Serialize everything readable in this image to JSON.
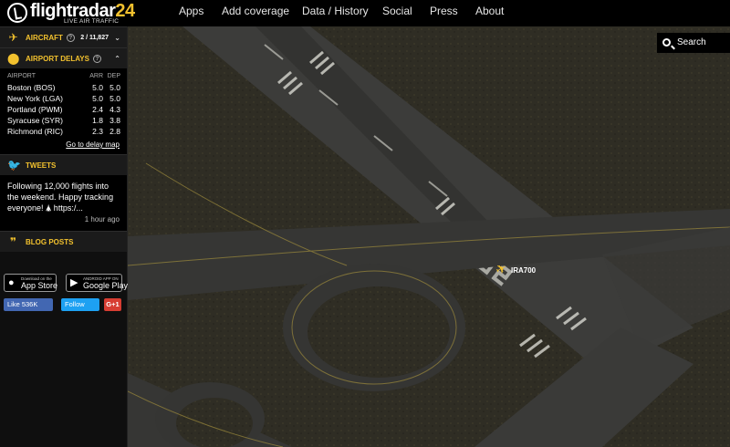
{
  "brand": {
    "name_main": "flightradar",
    "name_num": "24",
    "tagline": "LIVE AIR TRAFFIC"
  },
  "nav": [
    "Apps",
    "Add coverage",
    "Data / History",
    "Social",
    "Press",
    "About"
  ],
  "search": {
    "label": "Search"
  },
  "aircraft": {
    "title": "AIRCRAFT",
    "count": "2 / 11,827"
  },
  "delays": {
    "title": "AIRPORT DELAYS",
    "columns": [
      "AIRPORT",
      "ARR",
      "DEP"
    ],
    "rows": [
      [
        "Boston (BOS)",
        "5.0",
        "5.0"
      ],
      [
        "New York (LGA)",
        "5.0",
        "5.0"
      ],
      [
        "Portland (PWM)",
        "2.4",
        "4.3"
      ],
      [
        "Syracuse (SYR)",
        "1.8",
        "3.8"
      ],
      [
        "Richmond (RIC)",
        "2.3",
        "2.8"
      ]
    ],
    "link": "Go to delay map"
  },
  "tweets": {
    "title": "TWEETS",
    "text": "Following 12,000 flights into the weekend. Happy tracking everyone! 🛦 https:/...",
    "time": "1 hour ago"
  },
  "blog": {
    "title": "BLOG POSTS"
  },
  "stores": {
    "apple_small": "Download on the",
    "apple_big": "App Store",
    "google_small": "ANDROID APP ON",
    "google_big": "Google Play"
  },
  "social": {
    "fb": "Like 536K",
    "tw": "Follow",
    "gp": "G+1"
  },
  "map": {
    "callsign": "IRA700",
    "runway_number": "32"
  },
  "colors": {
    "accent": "#f2c12e",
    "facebook": "#4267b2",
    "twitter": "#1da1f2",
    "gplus": "#d73d32"
  }
}
